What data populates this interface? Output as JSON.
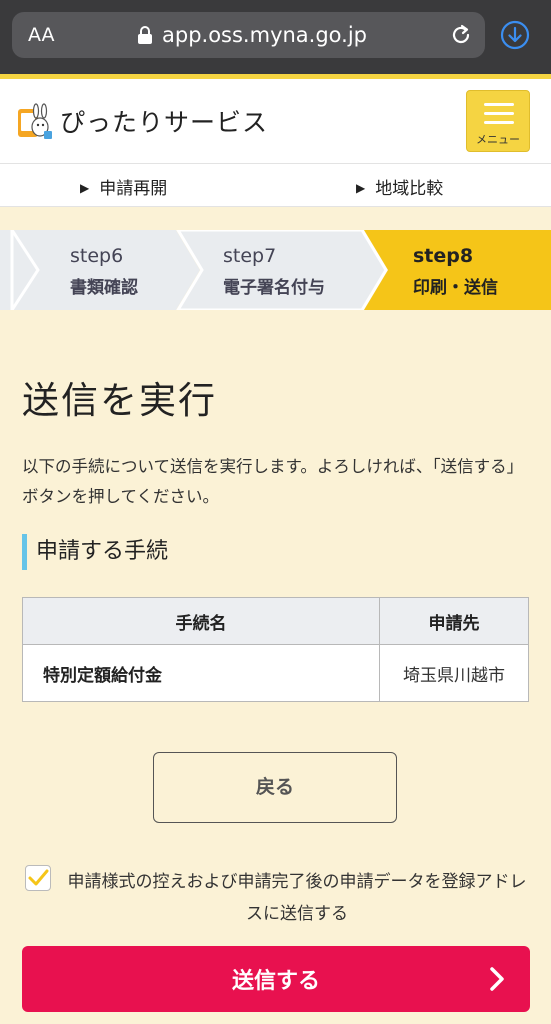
{
  "browser": {
    "text_size_label": "AA",
    "url": "app.oss.myna.go.jp",
    "icons": [
      "lock-icon",
      "reload-icon",
      "download-icon"
    ]
  },
  "header": {
    "site_name": "ぴったりサービス",
    "menu_label": "メニュー"
  },
  "sub_nav": {
    "items": [
      {
        "label": "申請再開"
      },
      {
        "label": "地域比較"
      }
    ]
  },
  "steps": [
    {
      "number": "step6",
      "label": "書類確認",
      "active": false
    },
    {
      "number": "step7",
      "label": "電子署名付与",
      "active": false
    },
    {
      "number": "step8",
      "label": "印刷・送信",
      "active": true
    }
  ],
  "main": {
    "title": "送信を実行",
    "description": "以下の手続について送信を実行します。よろしければ、「送信する」ボタンを押してください。",
    "section_heading": "申請する手続",
    "table": {
      "headers": [
        "手続名",
        "申請先"
      ],
      "rows": [
        [
          "特別定額給付金",
          "埼玉県川越市"
        ]
      ]
    },
    "back_label": "戻る",
    "consent": {
      "checked": true,
      "label": "申請様式の控えおよび申請完了後の申請データを登録アドレスに送信する"
    },
    "send_label": "送信する"
  },
  "colors": {
    "brand_yellow": "#f5d442",
    "page_background": "#fbf2d6",
    "send_button": "#e8114f",
    "heading_accent": "#66c4e8"
  }
}
